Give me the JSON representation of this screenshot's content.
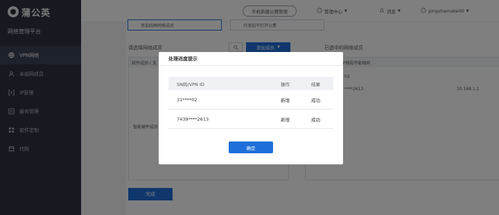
{
  "brand": {
    "name": "蒲公英"
  },
  "sidebar": {
    "platform_title": "网络管理平台",
    "items": [
      {
        "label": "VPN网络",
        "icon": "globe-icon",
        "active": true
      },
      {
        "label": "未组网成员",
        "icon": "user-icon",
        "active": false
      },
      {
        "label": "IP管理",
        "icon": "ip-icon",
        "active": false
      },
      {
        "label": "服务管理",
        "icon": "server-icon",
        "active": false
      },
      {
        "label": "软件定制",
        "icon": "grid-icon",
        "active": false
      },
      {
        "label": "代购",
        "icon": "cart-icon",
        "active": false
      }
    ]
  },
  "topbar": {
    "pill_label": "手机新建公费管理",
    "help_label": "管理中心",
    "messages_label": "消息",
    "user_label": "pingshamake00"
  },
  "main": {
    "option1": "添加四种网络成员",
    "option2": "只添加不打开公费",
    "select_label": "请选择网络成员",
    "add_button": "添加成员",
    "selected_label": "已选中的网络成员",
    "left_panel_head": "软件成员 ( 支",
    "left_panel_lower": "智能硬件成员",
    "right_panel_head": "选中，各组网成员IP网段不能相同",
    "right_row1": "02",
    "right_row2": "****2613",
    "right_ip": "10.168.1.1",
    "done_button": "完成"
  },
  "dialog": {
    "title": "处理进度提示",
    "columns": [
      "SN码/VPN ID",
      "操作",
      "结果"
    ],
    "rows": [
      {
        "sn": "31****02",
        "op": "新增",
        "result": "成功"
      },
      {
        "sn": "7439****2613",
        "op": "新增",
        "result": "成功"
      }
    ],
    "confirm": "确定"
  },
  "colors": {
    "accent": "#1e6fd9",
    "sidebar": "#2d3341"
  }
}
